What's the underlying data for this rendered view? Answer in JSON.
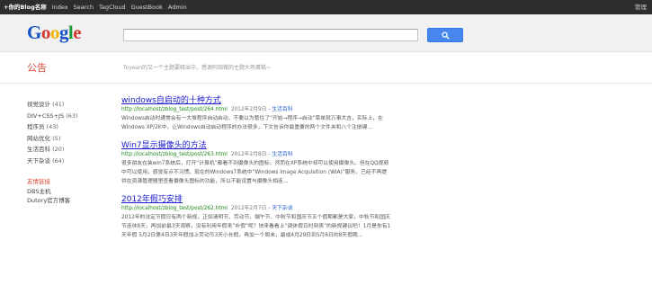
{
  "topnav": {
    "items": [
      "+你的Blog名称",
      "Index",
      "Search",
      "TagCloud",
      "GuestBook",
      "Admin"
    ],
    "right_label": "管理"
  },
  "header": {
    "logo": [
      "G",
      "o",
      "o",
      "g",
      "l",
      "e"
    ],
    "search": {
      "value": "",
      "placeholder": ""
    }
  },
  "notice": {
    "label": "公告",
    "text": "Toyean的又一个主题要释出中，感谢阿田做的主题大熟蛋糕~"
  },
  "sidebar": {
    "categories": [
      {
        "name": "视觉设计",
        "count": "(41)"
      },
      {
        "name": "DIV+CSS+JS",
        "count": "(63)"
      },
      {
        "name": "程序员",
        "count": "(43)"
      },
      {
        "name": "网站优化",
        "count": "(5)"
      },
      {
        "name": "生活百科",
        "count": "(20)"
      },
      {
        "name": "天下杂谈",
        "count": "(64)"
      }
    ],
    "links_title": "友情链接",
    "links": [
      "DBS主机",
      "Dutory官方博客"
    ]
  },
  "posts": [
    {
      "title": "windows自启动的十种方式",
      "url": "http://localhost/zblog_test/post/264.html",
      "date": "2012年2月9日",
      "category": "- 生活百科",
      "excerpt": "Windows启动时通常会有一大堆程序自动启动，不要以为管住了“开始→程序→启动”菜单就万事大吉，实际上，在Windows XP/2K中，让Windows自动启动程序的办法很多，下文告诉你最重要的两个文件夹和八个注册键..."
    },
    {
      "title": "Win7显示摄像头的方法",
      "url": "http://localhost/zblog_test/post/263.html",
      "date": "2012年2月8日",
      "category": "- 生活百科",
      "excerpt": "很多朋友在装win7系统后，打开“计算机”都看不到摄像头的图标，然而在XP系统中却可以使用摄像头。但在QQ视频中可以使用，感觉有点不习惯。现在的Windows7系统中“Windows Image Acquisition (WIA)”服务，已经不再提供在资源管理器里查看摄像头图标的功能，所以不能设置与摄像头相连..."
    },
    {
      "title": "2012年假巧安排",
      "url": "http://localhost/zblog_test/post/262.html",
      "date": "2012年2月7日",
      "category": "- 天下杂谈",
      "excerpt": "2012年的法定节假日有两个新规，正如清明节、劳动节、端午节、中秋节和国庆节五个假期都是大家，中秋节和国庆节连休8天，再加前最3天观察，没有利用年假来“补假”呢？快来看看上“调休假日时刻表”的新规建议吧！1月是你有1天年假 5月2日第4日3天年假加上劳动节3天小长假，再加一个周末，最成4月29日到5月6日的8天假期..."
    }
  ]
}
